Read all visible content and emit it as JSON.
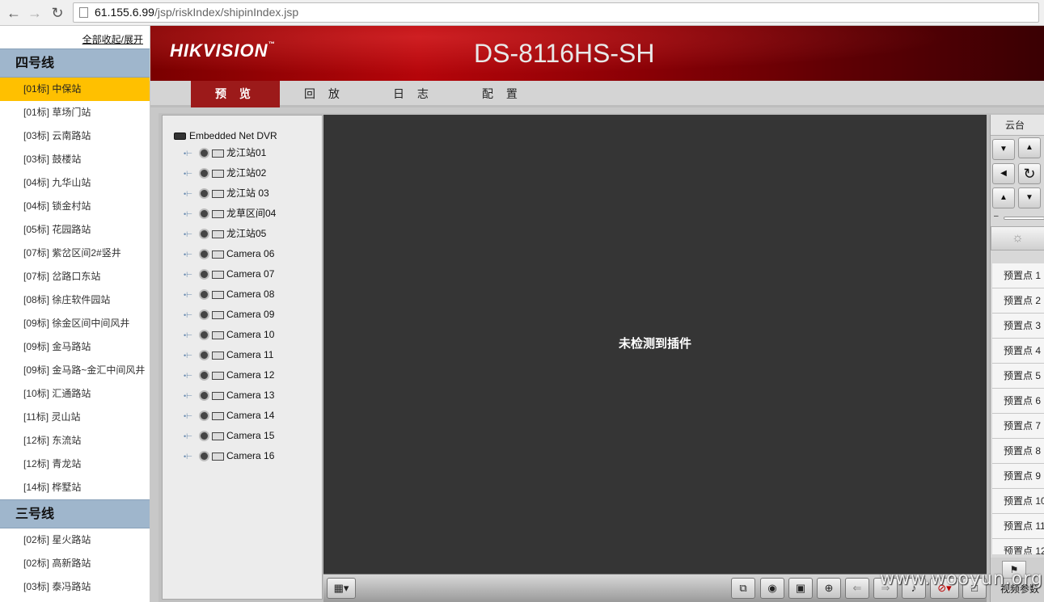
{
  "browser": {
    "back_icon": "arrow-left-icon",
    "forward_icon": "arrow-right-icon",
    "reload_icon": "reload-icon",
    "url_host": "61.155.6.99",
    "url_path": "/jsp/riskIndex/shipinIndex.jsp"
  },
  "sidebar": {
    "collapse_label": "全部收起/展开",
    "groups": [
      {
        "name": "四号线",
        "stations": [
          {
            "label": "[01标] 中保站",
            "active": true
          },
          {
            "label": "[01标] 草场门站"
          },
          {
            "label": "[03标] 云南路站"
          },
          {
            "label": "[03标] 鼓楼站"
          },
          {
            "label": "[04标] 九华山站"
          },
          {
            "label": "[04标] 锁金村站"
          },
          {
            "label": "[05标] 花园路站"
          },
          {
            "label": "[07标] 紫岔区间2#竖井"
          },
          {
            "label": "[07标] 岔路口东站"
          },
          {
            "label": "[08标] 徐庄软件园站"
          },
          {
            "label": "[09标] 徐金区间中间风井"
          },
          {
            "label": "[09标] 金马路站"
          },
          {
            "label": "[09标] 金马路~金汇中间风井"
          },
          {
            "label": "[10标] 汇通路站"
          },
          {
            "label": "[11标] 灵山站"
          },
          {
            "label": "[12标] 东流站"
          },
          {
            "label": "[12标] 青龙站"
          },
          {
            "label": "[14标] 桦墅站"
          }
        ]
      },
      {
        "name": "三号线",
        "stations": [
          {
            "label": "[02标] 星火路站"
          },
          {
            "label": "[02标] 高新路站"
          },
          {
            "label": "[03标] 泰冯路站"
          }
        ]
      }
    ]
  },
  "header": {
    "logo": "HIKVISION",
    "logo_tm": "™",
    "model": "DS-8116HS-SH",
    "accent_color": "#9c1a1a"
  },
  "tabs": [
    {
      "label": "预 览",
      "active": true
    },
    {
      "label": "回 放"
    },
    {
      "label": "日 志"
    },
    {
      "label": "配 置"
    }
  ],
  "tree": {
    "root": "Embedded Net DVR",
    "cameras": [
      "龙江站01",
      "龙江站02",
      "龙江站 03",
      "龙草区间04",
      "龙江站05",
      "Camera 06",
      "Camera 07",
      "Camera 08",
      "Camera 09",
      "Camera 10",
      "Camera 11",
      "Camera 12",
      "Camera 13",
      "Camera 14",
      "Camera 15",
      "Camera 16"
    ]
  },
  "video": {
    "message": "未检测到插件"
  },
  "toolbar": {
    "buttons": [
      "layout-grid-icon",
      "window-icon",
      "snapshot-camera-icon",
      "record-icon",
      "zoom-in-icon",
      "prev-icon",
      "next-icon",
      "microphone-icon",
      "mute-icon",
      "fullscreen-icon"
    ]
  },
  "ptz": {
    "title": "云台",
    "presets": [
      "预置点 1",
      "预置点 2",
      "预置点 3",
      "预置点 4",
      "预置点 5",
      "预置点 6",
      "预置点 7",
      "预置点 8",
      "预置点 9",
      "预置点 10",
      "预置点 11",
      "预置点 12"
    ],
    "video_param_label": "视频参数"
  },
  "watermark": "www.wooyun.org"
}
